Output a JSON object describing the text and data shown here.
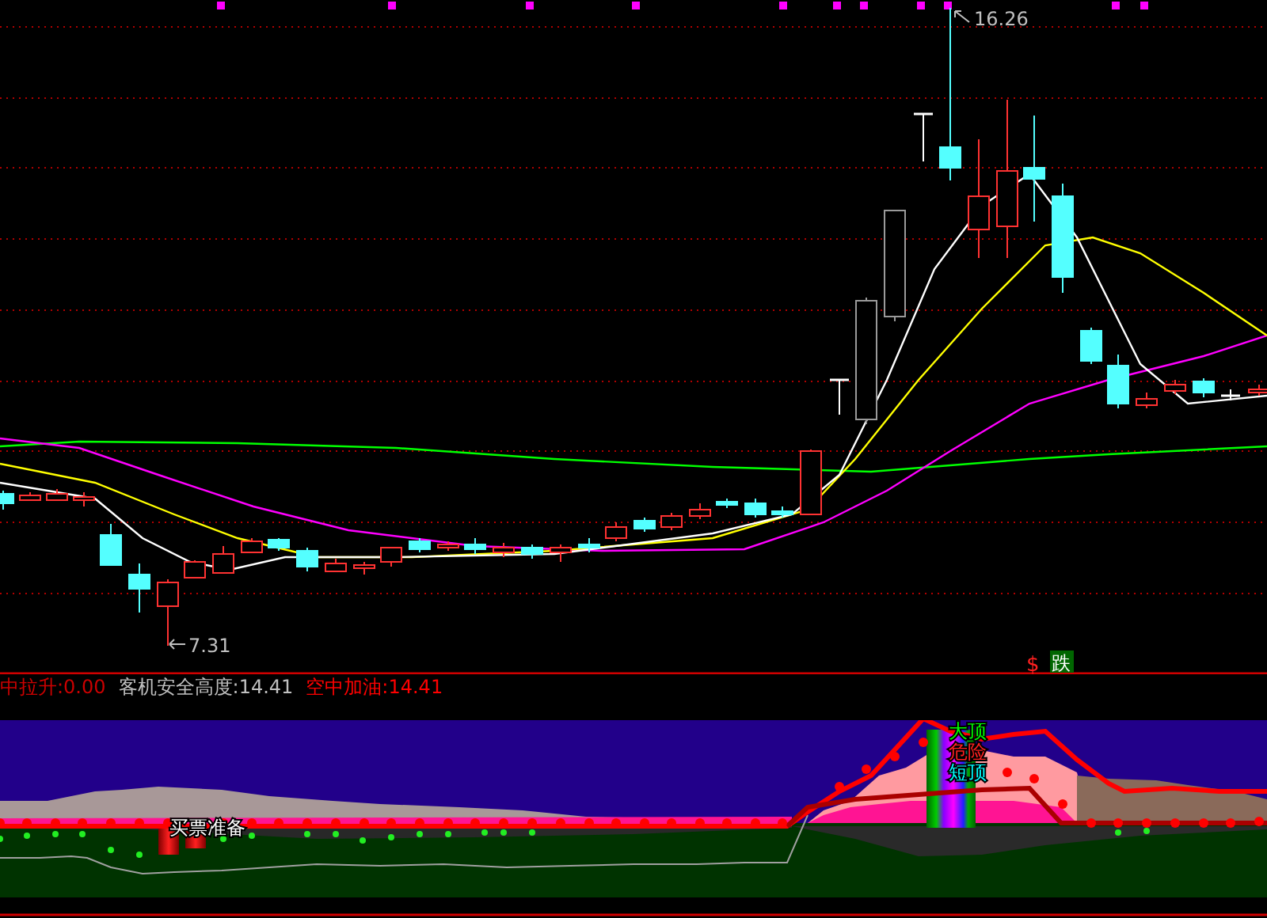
{
  "price_chart": {
    "high_label": "16.26",
    "low_label": "7.31",
    "signals": [
      {
        "kind": "dollar",
        "text": "$"
      },
      {
        "kind": "tag",
        "text": "跌"
      }
    ]
  },
  "indicator": {
    "readouts": [
      {
        "label": "中拉升:",
        "value": "0.00"
      },
      {
        "label": "客机安全高度:",
        "value": "14.41"
      },
      {
        "label": "空中加油:",
        "value": "14.41"
      }
    ],
    "annotations": [
      {
        "text": "买票准备"
      },
      {
        "text": "大顶"
      },
      {
        "text": "危险"
      },
      {
        "text": "短顶"
      }
    ]
  }
}
